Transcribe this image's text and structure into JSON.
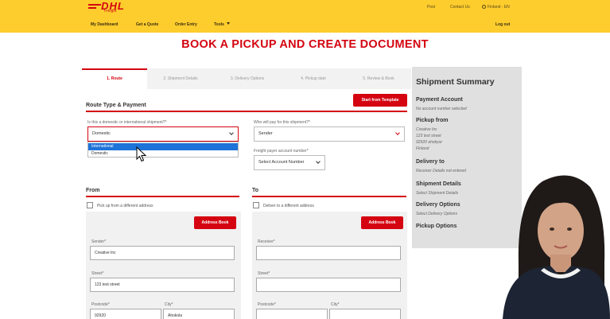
{
  "header": {
    "logo": "DHL",
    "logo_sub": "Freight",
    "top_links": [
      "Post",
      "Contact Us",
      "Finland - EN"
    ],
    "nav": [
      "My Dashboard",
      "Get a Quote",
      "Order Entry",
      "Tools"
    ],
    "logout": "Log out",
    "brand_yellow": "#fdcc2d",
    "brand_red": "#d40511"
  },
  "page_title": "BOOK A PICKUP AND CREATE DOCUMENT",
  "tabs": [
    "1. Route",
    "2. Shipment Details",
    "3. Delivery Options",
    "4. Pickup date",
    "5. Review & Book"
  ],
  "route": {
    "heading": "Route Type & Payment",
    "template_button": "Start from Template",
    "shipment_q": "Is this a domestic or international shipment?*",
    "shipment_value": "Domestic",
    "shipment_options": [
      "International",
      "Domestic"
    ],
    "payer_q": "Who will pay for this shipment?*",
    "payer_value": "Sender",
    "account_label": "Freight payer account number*",
    "account_value": "Select Account Number"
  },
  "from": {
    "heading": "From",
    "checkbox": "Pick up from a different address",
    "address_book": "Address Book",
    "sender_label": "Sender*",
    "sender_value": "Creative Inc",
    "street_label": "Street*",
    "street_value": "123 test street",
    "postcode_label": "Postcode*",
    "postcode_value": "92920",
    "city_label": "City*",
    "city_value": "Ahokola"
  },
  "to": {
    "heading": "To",
    "checkbox": "Deliver to a different address",
    "address_book": "Address Book",
    "receiver_label": "Receiver*",
    "street_label": "Street*",
    "postcode_label": "Postcode*",
    "city_label": "City*"
  },
  "summary": {
    "title": "Shipment Summary",
    "payment_head": "Payment Account",
    "payment_text": "No account number selected",
    "pickup_head": "Pickup from",
    "pickup_lines": [
      "Creative Inc",
      "123 test street",
      "92920 ahokyor",
      "Finland"
    ],
    "delivery_head": "Delivery to",
    "delivery_text": "Receiver Details not entered",
    "details_head": "Shipment Details",
    "details_text": "Select Shipment Details",
    "options_head": "Delivery Options",
    "options_text": "Select Delivery Options",
    "pickup_options_head": "Pickup Options"
  }
}
